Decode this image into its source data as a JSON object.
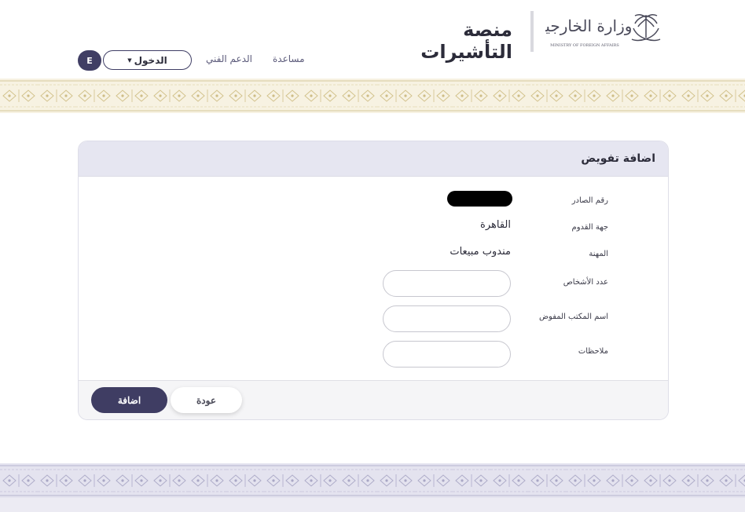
{
  "header": {
    "site_title": "منصة التأشيرات",
    "logo": {
      "arabic_text": "وزارة الخارجية",
      "english_text": "MINISTRY OF FOREIGN AFFAIRS",
      "icon": "saudi-emblem-icon"
    },
    "nav": {
      "help": "مساعدة",
      "support": "الدعم الفني",
      "login": "الدخول",
      "login_caret": "▼",
      "language": "E"
    }
  },
  "card": {
    "title": "اضافة تفويض",
    "fields": [
      {
        "label": "رقم الصادر",
        "value": ""
      },
      {
        "label": "جهة القدوم",
        "value": "القاهرة"
      },
      {
        "label": "المهنة",
        "value": "مندوب مبيعات"
      },
      {
        "label": "عدد الأشخاص",
        "input_value": ""
      },
      {
        "label": "اسم المكتب المفوض",
        "input_value": ""
      },
      {
        "label": "ملاحظات",
        "input_value": ""
      }
    ],
    "buttons": {
      "add": "اضافة",
      "back": "عودة"
    }
  },
  "colors": {
    "primary": "#3f3d63",
    "card_header": "#e6e6f1",
    "band_top": "#f7f2e2",
    "band_bottom": "#ecebf3"
  }
}
